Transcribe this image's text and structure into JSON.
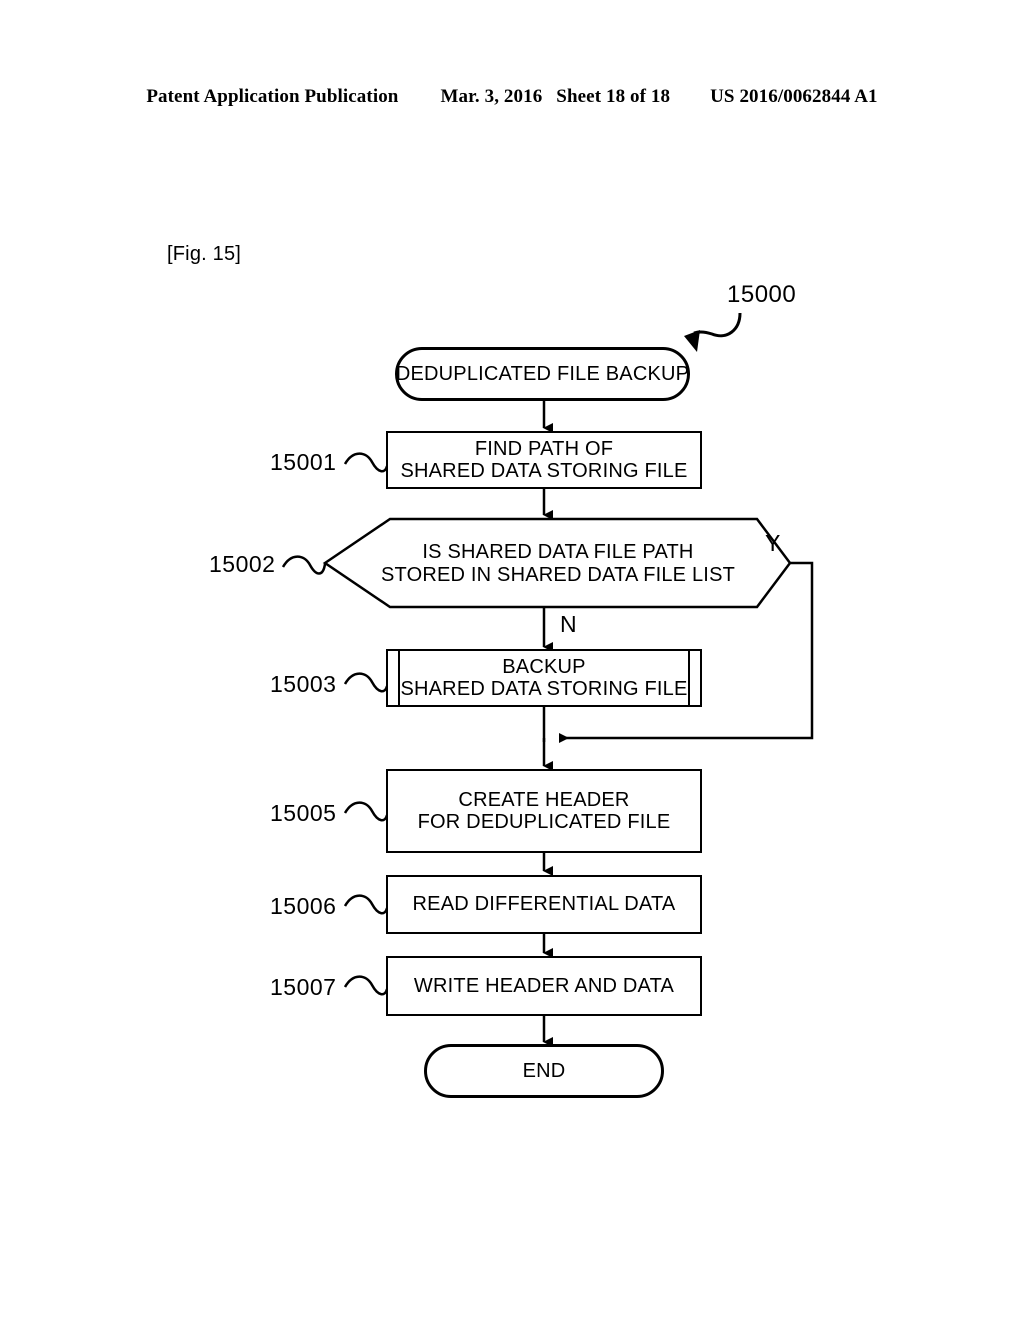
{
  "header": {
    "publication": "Patent Application Publication",
    "date": "Mar. 3, 2016",
    "sheet": "Sheet 18 of 18",
    "patent_number": "US 2016/0062844 A1"
  },
  "figure": {
    "label": "[Fig. 15]",
    "diagram_reference": "15000",
    "title_node": "DEDUPLICATED FILE BACKUP",
    "end_node": "END"
  },
  "nodes": {
    "start": {
      "ref": "",
      "text": "DEDUPLICATED FILE BACKUP",
      "shape": "terminal"
    },
    "s15001": {
      "ref": "15001",
      "line1": "FIND PATH OF",
      "line2": "SHARED DATA STORING FILE",
      "shape": "process"
    },
    "s15002": {
      "ref": "15002",
      "line1": "IS SHARED DATA FILE PATH",
      "line2": "STORED IN SHARED DATA FILE LIST",
      "shape": "decision"
    },
    "s15003": {
      "ref": "15003",
      "line1": "BACKUP",
      "line2": "SHARED DATA  STORING FILE",
      "shape": "subroutine"
    },
    "s15005": {
      "ref": "15005",
      "line1": "CREATE HEADER",
      "line2": "FOR DEDUPLICATED FILE",
      "shape": "process"
    },
    "s15006": {
      "ref": "15006",
      "line1": "READ DIFFERENTIAL DATA",
      "line2": "",
      "shape": "process"
    },
    "s15007": {
      "ref": "15007",
      "line1": "WRITE HEADER AND DATA",
      "line2": "",
      "shape": "process"
    },
    "end": {
      "ref": "",
      "text": "END",
      "shape": "terminal"
    }
  },
  "branches": {
    "yes": "Y",
    "no": "N"
  },
  "colors": {
    "ink": "#000000",
    "paper": "#ffffff"
  }
}
